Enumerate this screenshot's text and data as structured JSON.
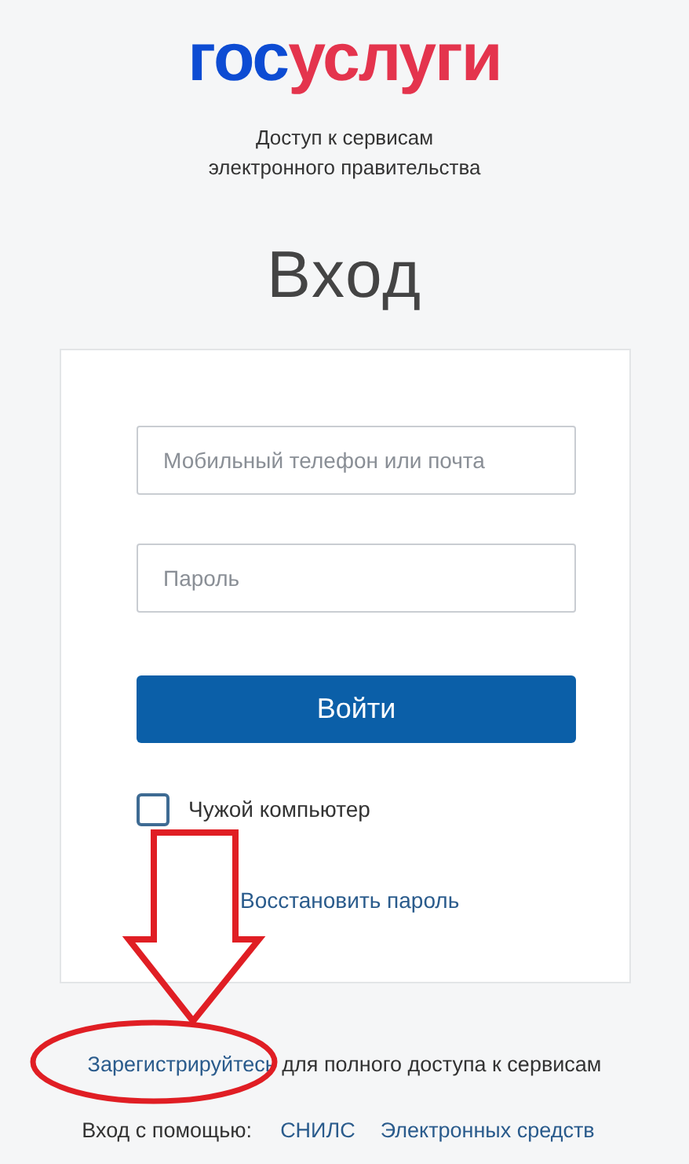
{
  "logo": {
    "dark_part": "гос",
    "accent_part": "услуги"
  },
  "tagline": [
    "Доступ к сервисам",
    "электронного правительства"
  ],
  "title": "Вход",
  "form": {
    "login": {
      "placeholder": "Мобильный телефон или почта"
    },
    "password": {
      "placeholder": "Пароль"
    },
    "submit": "Войти",
    "foreign_computer": {
      "label": "Чужой компьютер",
      "checked": false
    },
    "restore_link": "Восстановить пароль"
  },
  "register": {
    "link": "Зарегистрируйтесь",
    "text": "для полного доступа к сервисам"
  },
  "alt_login": {
    "label": "Вход с помощью:",
    "links": [
      "СНИЛС",
      "Электронных средств"
    ]
  }
}
